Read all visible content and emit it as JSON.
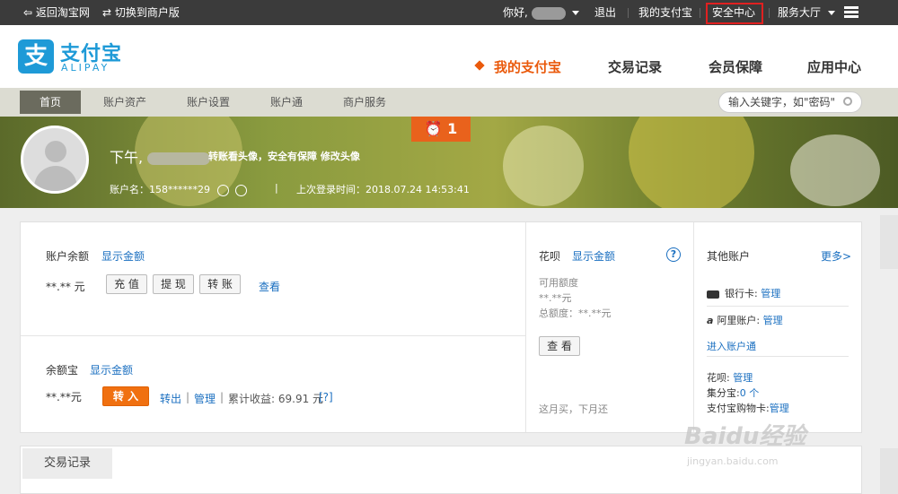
{
  "topbar": {
    "back_taobao": "返回淘宝网",
    "switch_merchant": "切换到商户版",
    "greeting": "你好,",
    "logout": "退出",
    "my_alipay": "我的支付宝",
    "security_center": "安全中心",
    "service_hall": "服务大厅"
  },
  "header": {
    "logo_cn": "支付宝",
    "logo_en": "ALIPAY",
    "logo_glyph": "支",
    "nav": [
      "我的支付宝",
      "交易记录",
      "会员保障",
      "应用中心"
    ]
  },
  "subnav": {
    "tabs": [
      "首页",
      "账户资产",
      "账户设置",
      "账户通",
      "商户服务"
    ],
    "search_placeholder": "输入关键字，如\"密码\""
  },
  "banner": {
    "alert_count": "1",
    "greeting": "下午,",
    "avatar_tip": "转账看头像，安全有保障 修改头像",
    "account_label": "账户名：158******29",
    "last_login": "上次登录时间：2018.07.24 14:53:41"
  },
  "balance": {
    "label": "账户余额",
    "show": "显示金额",
    "amount": "**.** 元",
    "recharge": "充 值",
    "withdraw": "提 现",
    "transfer": "转 账",
    "view": "查看"
  },
  "yuebao": {
    "label": "余额宝",
    "show": "显示金额",
    "amount": "**.**元",
    "transfer_in": "转 入",
    "transfer_out": "转出",
    "manage": "管理",
    "earnings_label": "累计收益: 69.91 元",
    "hint": "[?]"
  },
  "huabei": {
    "label": "花呗",
    "show": "显示金额",
    "help": "?",
    "available_label": "可用额度",
    "available_amount": "**.**元",
    "total": "总额度：**.**元",
    "view": "查 看",
    "slogan": "这月买，下月还"
  },
  "other_accounts": {
    "title": "其他账户",
    "more": "更多>",
    "bank_card": "银行卡: ",
    "bank_manage": "管理",
    "ali_account": "阿里账户: ",
    "ali_manage": "管理",
    "enter_account": "进入账户通",
    "huabei": "花呗: ",
    "huabei_manage": "管理",
    "jifenbao": "集分宝:",
    "jifenbao_count": "0 个",
    "shopping": "支付宝购物卡:",
    "shopping_manage": "管理"
  },
  "transactions": {
    "tab": "交易记录"
  },
  "watermark": {
    "brand": "Baidu经验",
    "url": "jingyan.baidu.com"
  },
  "colors": {
    "accent_orange": "#ea5a0c",
    "alipay_blue": "#1e9ad7",
    "link_blue": "#1a6fc0",
    "topbar_bg": "#3b3b3b",
    "highlight_red": "#e02020"
  }
}
